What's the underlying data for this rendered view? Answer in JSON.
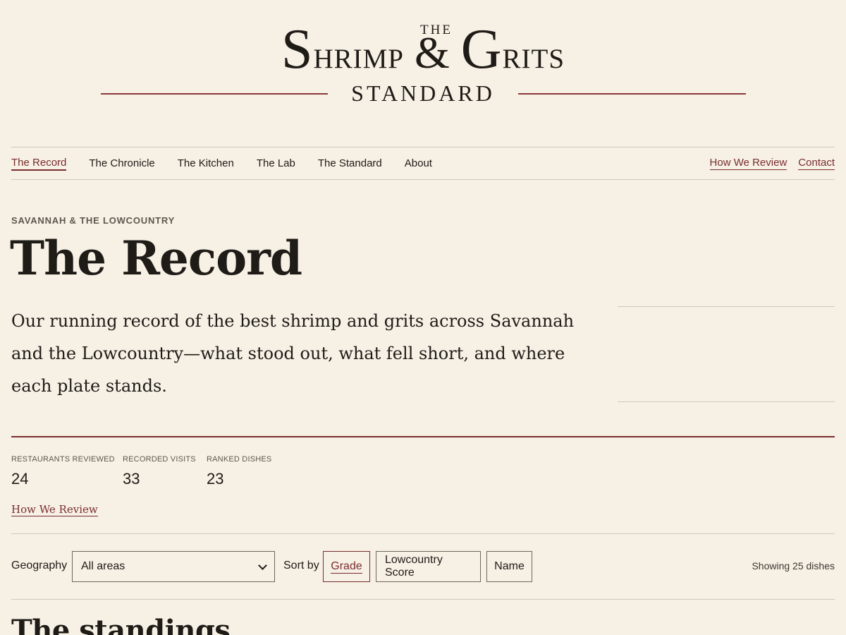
{
  "masthead": {
    "the": "THE",
    "shrimp_s": "S",
    "shrimp_rest": "hrimp",
    "amp": "&",
    "grits_g": "G",
    "grits_rest": "rits",
    "standard": "STANDARD"
  },
  "nav": {
    "items": [
      {
        "label": "The Record",
        "active": true
      },
      {
        "label": "The Chronicle"
      },
      {
        "label": "The Kitchen"
      },
      {
        "label": "The Lab"
      },
      {
        "label": "The Standard"
      },
      {
        "label": "About"
      }
    ],
    "right": [
      {
        "label": "How We Review"
      },
      {
        "label": "Contact"
      }
    ]
  },
  "hero": {
    "eyebrow": "SAVANNAH & THE LOWCOUNTRY",
    "title": "The Record",
    "intro": "Our running record of the best shrimp and grits across Savannah and the Lowcountry—what stood out, what fell short, and where each plate stands."
  },
  "stats": [
    {
      "label": "RESTAURANTS REVIEWED",
      "value": "24"
    },
    {
      "label": "RECORDED VISITS",
      "value": "33"
    },
    {
      "label": "RANKED DISHES",
      "value": "23"
    }
  ],
  "review_link": "How We Review",
  "filters": {
    "geography_label": "Geography",
    "geography_value": "All areas",
    "sort_label": "Sort by",
    "sort_options": [
      {
        "label": "Grade",
        "active": true
      },
      {
        "label": "Lowcountry Score"
      },
      {
        "label": "Name"
      }
    ],
    "showing": "Showing 25 dishes"
  },
  "section_title": "The standings",
  "colors": {
    "background": "#f6f0e5",
    "accent": "#7a2e2e",
    "text": "#1f1b17"
  }
}
